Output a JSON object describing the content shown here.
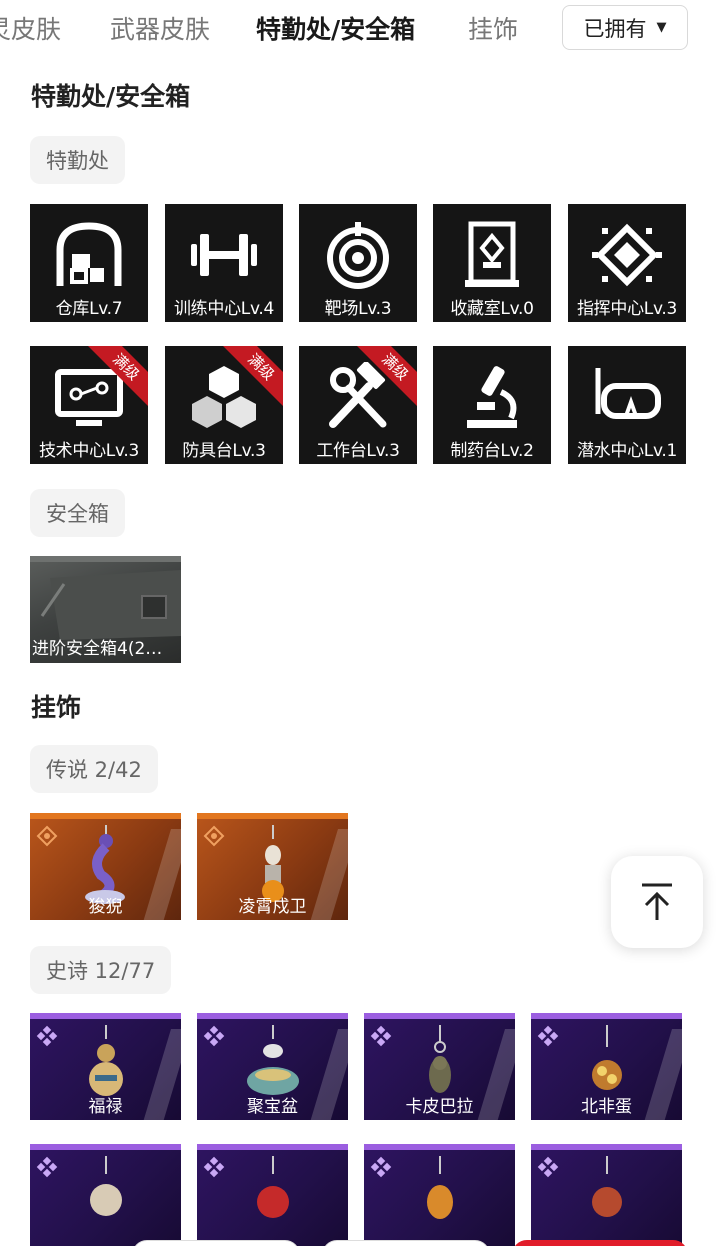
{
  "tabs": [
    {
      "label": "灵皮肤"
    },
    {
      "label": "武器皮肤"
    },
    {
      "label": "特勤处/安全箱"
    },
    {
      "label": "挂饰"
    }
  ],
  "filter": {
    "label": "已拥有"
  },
  "section_agency": {
    "title": "特勤处/安全箱",
    "chip": "特勤处",
    "facilities": [
      {
        "label": "仓库Lv.7",
        "icon": "warehouse-icon",
        "maxed": false
      },
      {
        "label": "训练中心Lv.4",
        "icon": "dumbbell-icon",
        "maxed": false
      },
      {
        "label": "靶场Lv.3",
        "icon": "target-icon",
        "maxed": false
      },
      {
        "label": "收藏室Lv.0",
        "icon": "display-case-icon",
        "maxed": false
      },
      {
        "label": "指挥中心Lv.3",
        "icon": "chip-icon",
        "maxed": false
      },
      {
        "label": "技术中心Lv.3",
        "icon": "monitor-icon",
        "maxed": true
      },
      {
        "label": "防具台Lv.3",
        "icon": "cubes-icon",
        "maxed": true
      },
      {
        "label": "工作台Lv.3",
        "icon": "hammer-wrench-icon",
        "maxed": true
      },
      {
        "label": "制药台Lv.2",
        "icon": "microscope-icon",
        "maxed": false
      },
      {
        "label": "潜水中心Lv.1",
        "icon": "diving-mask-icon",
        "maxed": false
      }
    ],
    "ribbon_label": "满级",
    "safe_chip": "安全箱",
    "safe": {
      "label": "进阶安全箱4(2…"
    }
  },
  "section_charms": {
    "title": "挂饰",
    "legend_chip": "传说 2/42",
    "legend_items": [
      {
        "label": "狻猊"
      },
      {
        "label": "凌霄戍卫"
      }
    ],
    "epic_chip": "史诗 12/77",
    "epic_items": [
      {
        "label": "福禄"
      },
      {
        "label": "聚宝盆"
      },
      {
        "label": "卡皮巴拉"
      },
      {
        "label": "北非蛋"
      },
      {
        "label": ""
      },
      {
        "label": ""
      },
      {
        "label": ""
      },
      {
        "label": ""
      }
    ]
  },
  "colors": {
    "legend": "#b8551b",
    "epic": "#2e1460",
    "ribbon": "#c41a22",
    "accent_red": "#e11d2a"
  }
}
